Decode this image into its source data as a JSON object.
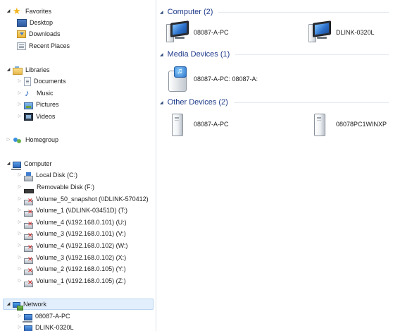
{
  "nav": {
    "favorites": {
      "label": "Favorites",
      "items": [
        {
          "label": "Desktop",
          "icon": "desktop-icon"
        },
        {
          "label": "Downloads",
          "icon": "downloads-icon"
        },
        {
          "label": "Recent Places",
          "icon": "recent-places-icon"
        }
      ]
    },
    "libraries": {
      "label": "Libraries",
      "items": [
        {
          "label": "Documents",
          "icon": "documents-icon"
        },
        {
          "label": "Music",
          "icon": "music-icon"
        },
        {
          "label": "Pictures",
          "icon": "pictures-icon"
        },
        {
          "label": "Videos",
          "icon": "videos-icon"
        }
      ]
    },
    "homegroup": {
      "label": "Homegroup"
    },
    "computer": {
      "label": "Computer",
      "items": [
        {
          "label": "Local Disk (C:)",
          "icon": "local-disk-icon"
        },
        {
          "label": "Removable Disk (F:)",
          "icon": "removable-disk-icon"
        },
        {
          "label": "Volume_50_snapshot (\\\\DLINK-570412)",
          "icon": "disconnected-network-drive-icon"
        },
        {
          "label": "Volume_1 (\\\\DLINK-03451D) (T:)",
          "icon": "disconnected-network-drive-icon"
        },
        {
          "label": "Volume_4 (\\\\192.168.0.101) (U:)",
          "icon": "disconnected-network-drive-icon"
        },
        {
          "label": "Volume_3 (\\\\192.168.0.101) (V:)",
          "icon": "disconnected-network-drive-icon"
        },
        {
          "label": "Volume_4 (\\\\192.168.0.102) (W:)",
          "icon": "disconnected-network-drive-icon"
        },
        {
          "label": "Volume_3 (\\\\192.168.0.102) (X:)",
          "icon": "disconnected-network-drive-icon"
        },
        {
          "label": "Volume_2 (\\\\192.168.0.105) (Y:)",
          "icon": "disconnected-network-drive-icon"
        },
        {
          "label": "Volume_1 (\\\\192.168.0.105) (Z:)",
          "icon": "disconnected-network-drive-icon"
        }
      ]
    },
    "network": {
      "label": "Network",
      "items": [
        {
          "label": "08087-A-PC",
          "icon": "computer-icon"
        },
        {
          "label": "DLINK-0320L",
          "icon": "computer-icon"
        }
      ]
    }
  },
  "content": {
    "groups": [
      {
        "title": "Computer (2)",
        "items": [
          {
            "label": "08087-A-PC",
            "icon": "network-computer-icon"
          },
          {
            "label": "DLINK-0320L",
            "icon": "network-computer-icon"
          }
        ]
      },
      {
        "title": "Media Devices (1)",
        "items": [
          {
            "label": "08087-A-PC: 08087-A:",
            "icon": "media-server-icon"
          }
        ]
      },
      {
        "title": "Other Devices (2)",
        "items": [
          {
            "label": "08087-A-PC",
            "icon": "device-icon"
          },
          {
            "label": "08078PC1WINXP",
            "icon": "device-icon"
          }
        ]
      }
    ]
  },
  "colors": {
    "group_header_text": "#1e3a8a",
    "selection_background": "#e2eefc",
    "selection_border": "#b8d4f2"
  }
}
